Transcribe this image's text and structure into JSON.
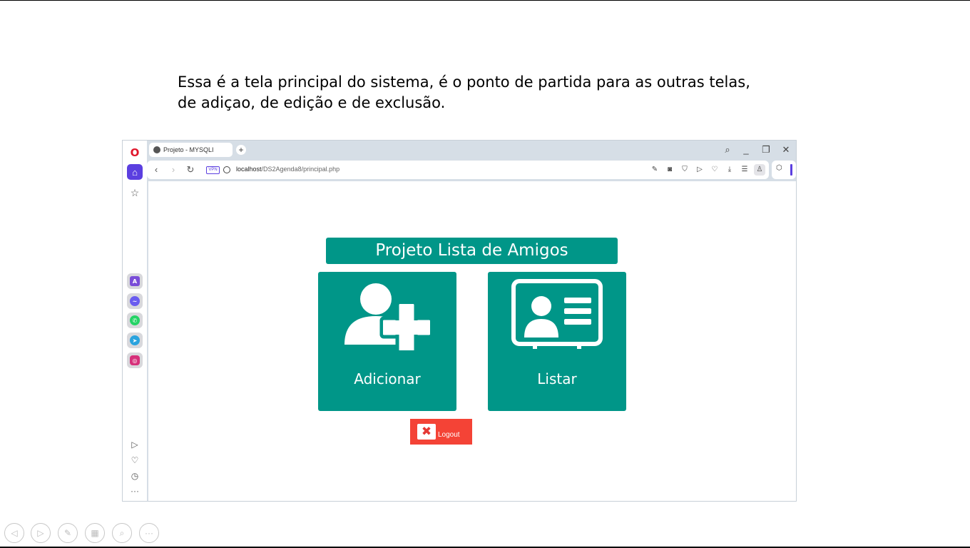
{
  "caption": {
    "line1": "Essa é a tela principal do sistema, é o ponto de partida para as outras telas,",
    "line2": "de adiçao, de edição e de exclusão."
  },
  "browser": {
    "tab_title": "Projeto - MYSQLI",
    "url_host": "localhost",
    "url_path": "/DS2Agenda8/principal.php",
    "vpn_badge": "VPN",
    "brand_color": "#e0162b",
    "accent_color": "#5b3fe0"
  },
  "app": {
    "title": "Projeto Lista de Amigos",
    "add_label": "Adicionar",
    "list_label": "Listar",
    "logout_label": "Logout",
    "card_color": "#009688",
    "logout_color": "#f44336"
  }
}
